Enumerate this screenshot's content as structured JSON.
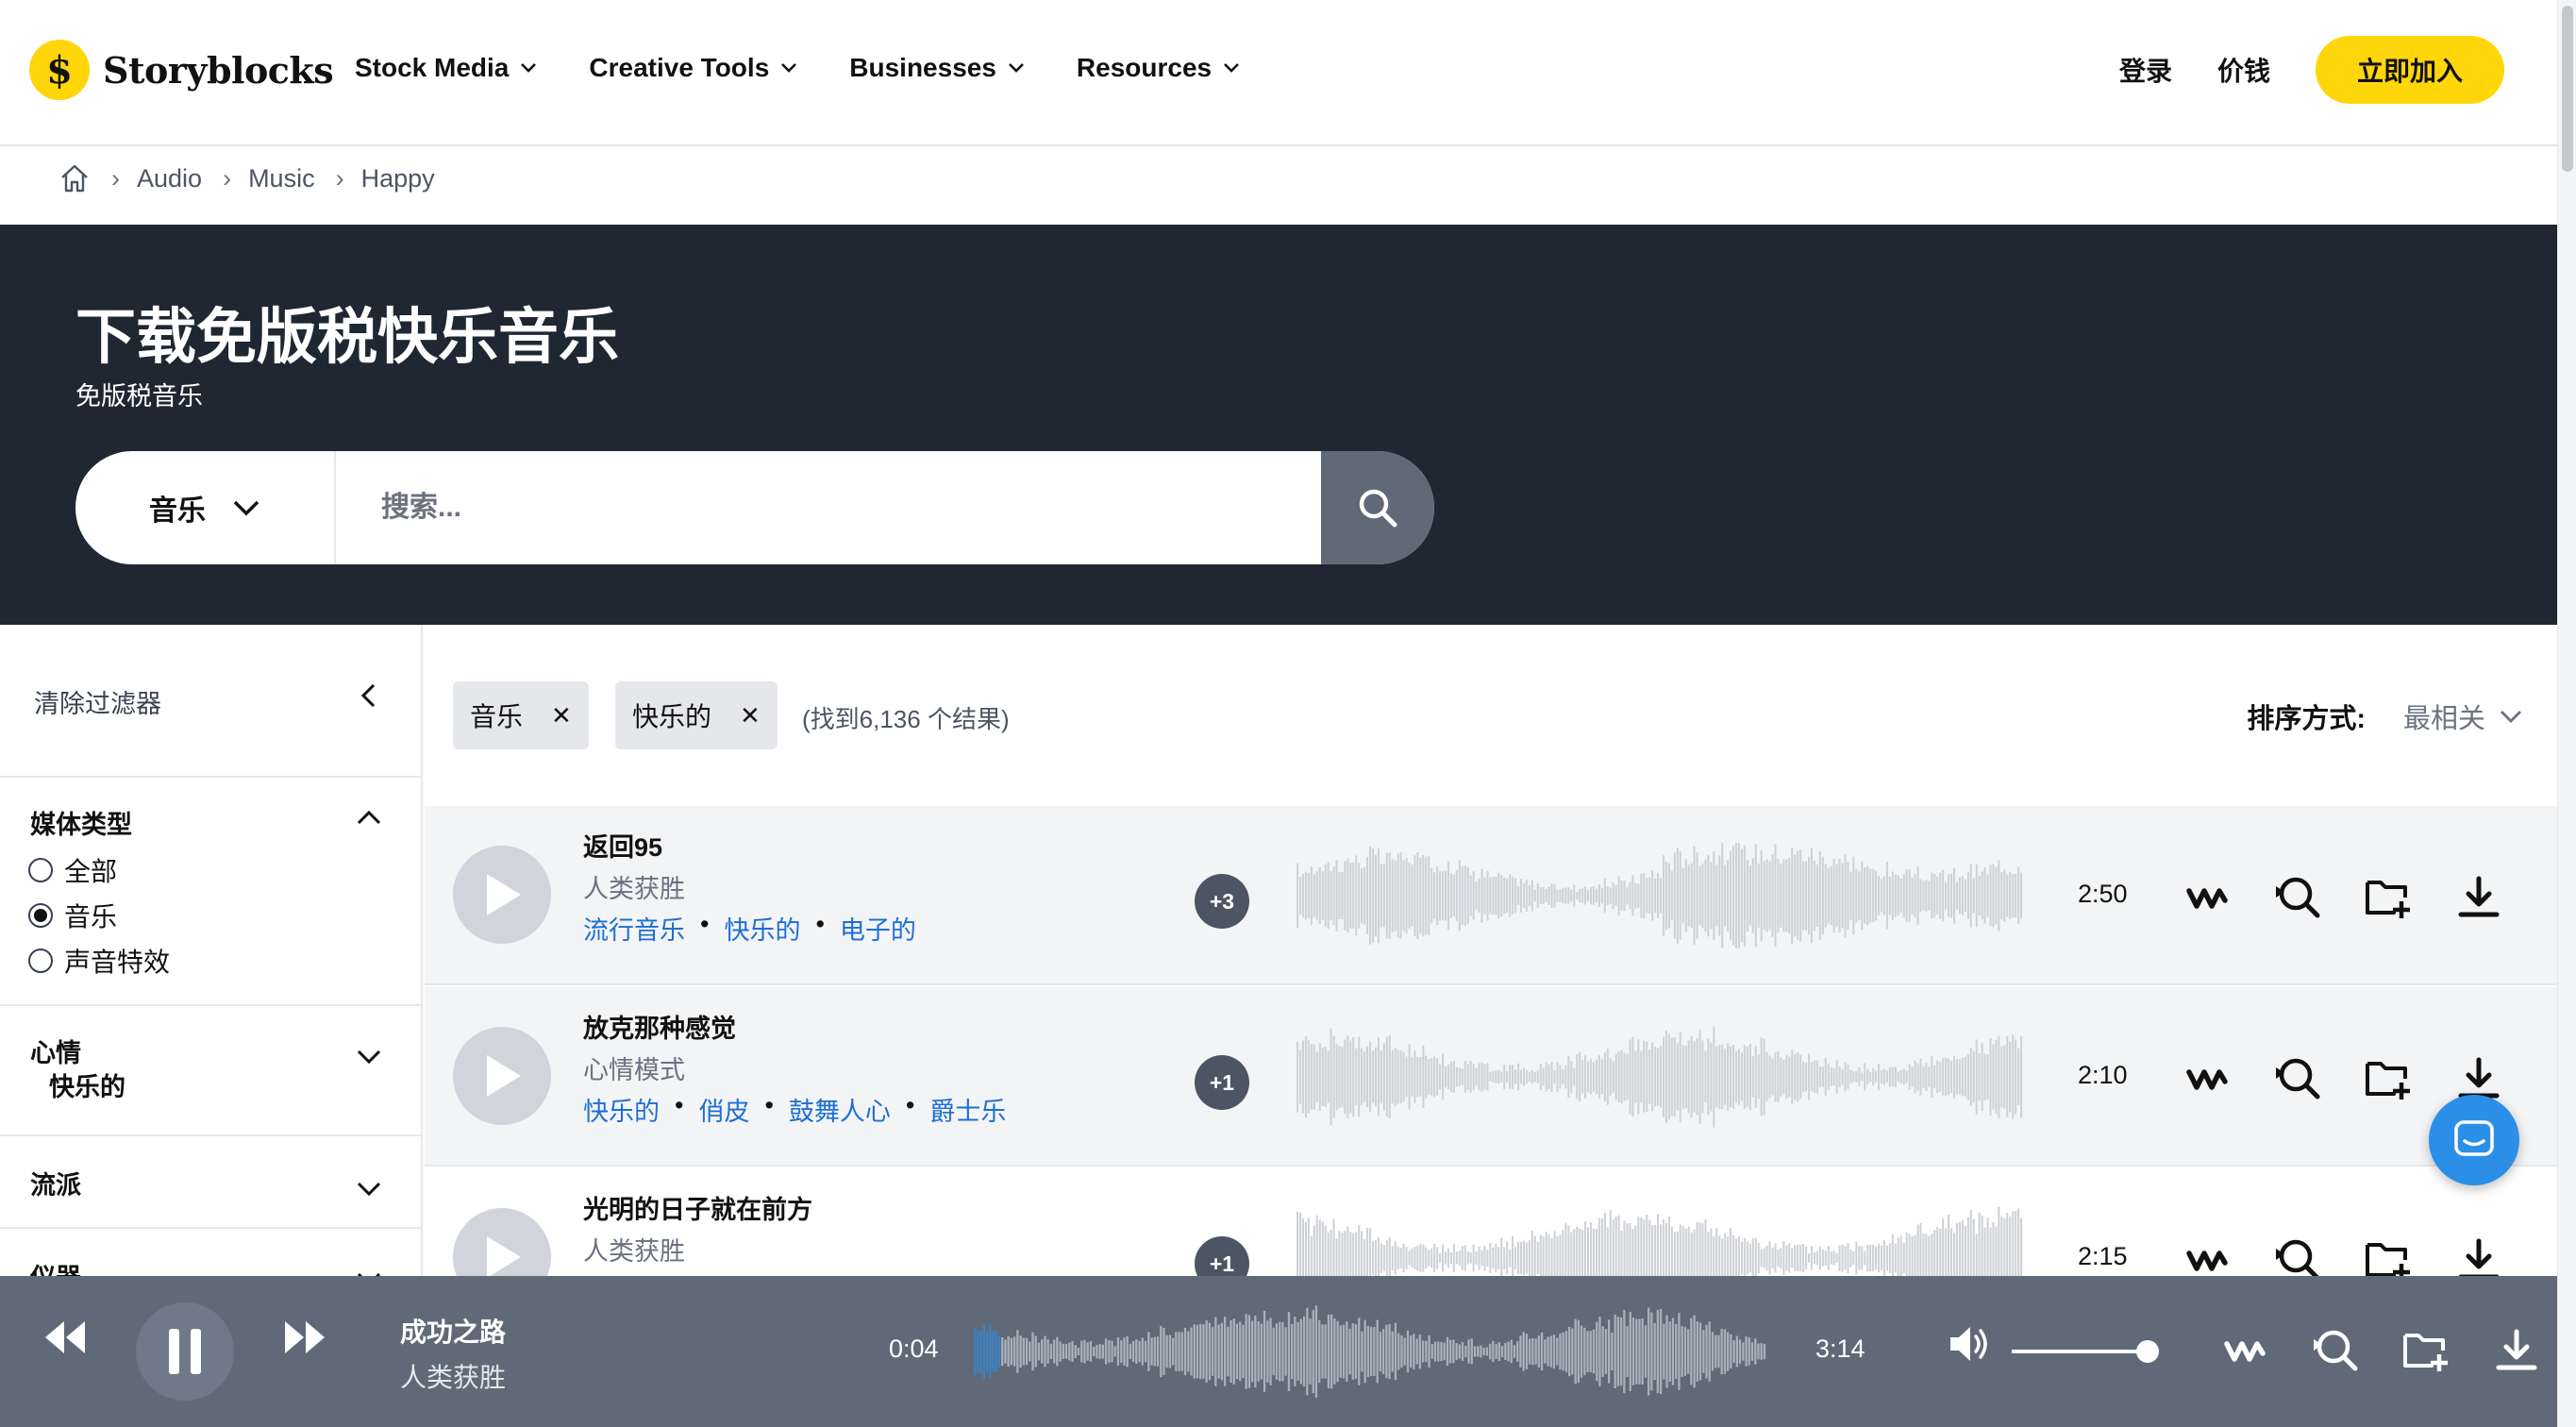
{
  "nav": {
    "logo_text": "Storyblocks",
    "menu": [
      "Stock Media",
      "Creative Tools",
      "Businesses",
      "Resources"
    ],
    "login": "登录",
    "pricing": "价钱",
    "join": "立即加入"
  },
  "breadcrumb": [
    "Audio",
    "Music",
    "Happy"
  ],
  "hero": {
    "title": "下载免版税快乐音乐",
    "subtitle": "免版税音乐",
    "search_type": "音乐",
    "search_placeholder": "搜索..."
  },
  "sidebar": {
    "clear_filters": "清除过滤器",
    "media_type": {
      "title": "媒体类型",
      "options": [
        "全部",
        "音乐",
        "声音特效"
      ],
      "selected": "音乐"
    },
    "mood": {
      "title": "心情",
      "value": "快乐的"
    },
    "genre": {
      "title": "流派"
    },
    "instrument": {
      "title": "仪器"
    }
  },
  "results": {
    "chips": [
      "音乐",
      "快乐的"
    ],
    "found": "(找到6,136 个结果)",
    "sort_label": "排序方式:",
    "sort_value": "最相关",
    "tracks": [
      {
        "title": "返回95",
        "artist": "人类获胜",
        "tags": [
          "流行音乐",
          "快乐的",
          "电子的"
        ],
        "plus": "+3",
        "duration": "2:50"
      },
      {
        "title": "放克那种感觉",
        "artist": "心情模式",
        "tags": [
          "快乐的",
          "俏皮",
          "鼓舞人心",
          "爵士乐"
        ],
        "plus": "+1",
        "duration": "2:10"
      },
      {
        "title": "光明的日子就在前方",
        "artist": "人类获胜",
        "tags": [],
        "plus": "+1",
        "duration": "2:15"
      }
    ]
  },
  "player": {
    "title": "成功之路",
    "artist": "人类获胜",
    "elapsed": "0:04",
    "total": "3:14",
    "progress_fraction": 0.02,
    "volume_fraction": 0.9
  },
  "colors": {
    "brand_yellow": "#ffd60a",
    "hero_bg": "#1f2732",
    "player_bg": "#5f6978",
    "tag_blue": "#1d6fd6",
    "chat_blue": "#2b8fe8"
  }
}
